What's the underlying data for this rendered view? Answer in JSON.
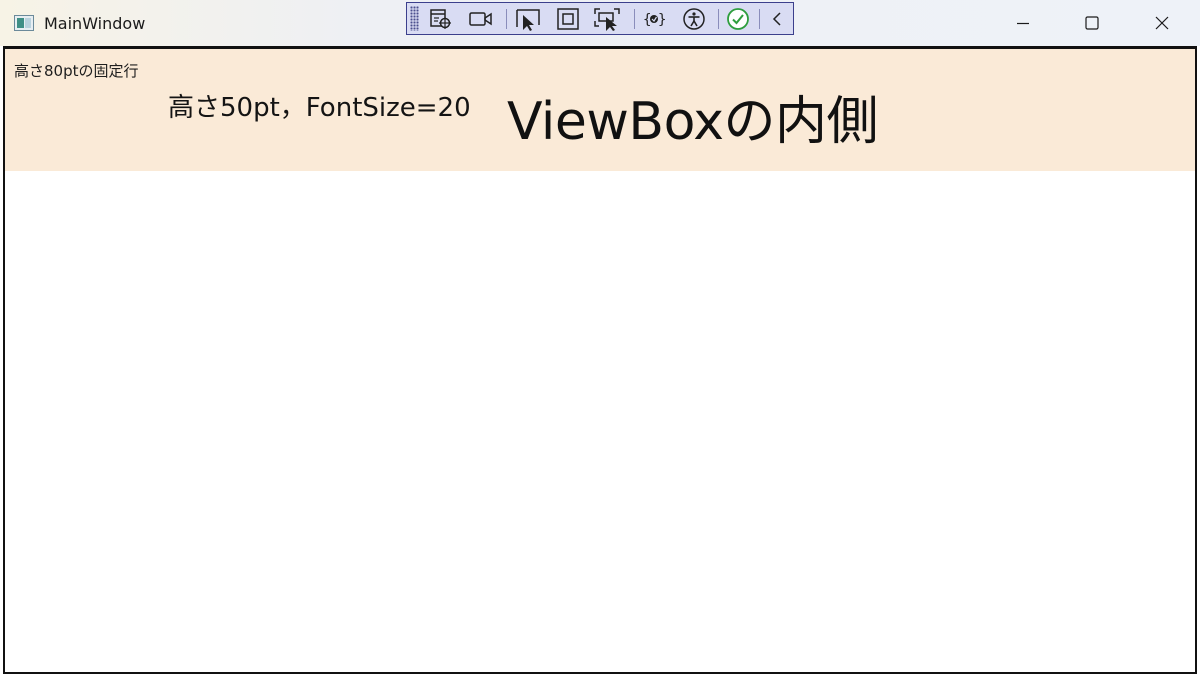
{
  "window": {
    "title": "MainWindow"
  },
  "debug_toolbar": {
    "icons": [
      "select-element-in-app-icon",
      "record-video-icon",
      "selection-mode-icon",
      "display-layout-adorners-icon",
      "track-focused-element-icon",
      "binding-failures-icon",
      "accessibility-checker-icon",
      "scan-checkmark-icon",
      "collapse-toolbar-icon"
    ]
  },
  "content": {
    "fixed_row_label": "高さ80ptの固定行",
    "mid_label": "高さ50pt，FontSize=20",
    "viewbox_label": "ViewBoxの内側"
  },
  "colors": {
    "fixed_row_background": "#faead7",
    "toolbar_background": "#d9dcf3",
    "toolbar_border": "#3b3f8c",
    "check_green": "#2e9e3e"
  }
}
